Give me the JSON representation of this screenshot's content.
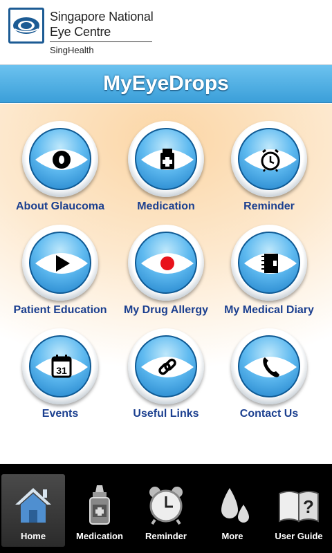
{
  "header": {
    "org_line1": "Singapore National",
    "org_line2": "Eye Centre",
    "org_line3": "SingHealth"
  },
  "app": {
    "title": "MyEyeDrops"
  },
  "colors": {
    "brand_blue": "#1c5b94",
    "label_blue": "#1b3f8f",
    "titlebar": "#4aaee2"
  },
  "tiles": [
    {
      "label": "About Glaucoma",
      "icon": "pupil-icon"
    },
    {
      "label": "Medication",
      "icon": "medicine-bottle-icon"
    },
    {
      "label": "Reminder",
      "icon": "alarm-clock-icon"
    },
    {
      "label": "Patient Education",
      "icon": "play-icon"
    },
    {
      "label": "My Drug Allergy",
      "icon": "red-dot-icon"
    },
    {
      "label": "My Medical Diary",
      "icon": "diary-icon"
    },
    {
      "label": "Events",
      "icon": "calendar-icon"
    },
    {
      "label": "Useful Links",
      "icon": "link-icon"
    },
    {
      "label": "Contact Us",
      "icon": "phone-icon"
    }
  ],
  "calendar_day": "31",
  "tabbar": {
    "items": [
      {
        "label": "Home",
        "icon": "home-icon",
        "active": true
      },
      {
        "label": "Medication",
        "icon": "eye-drop-bottle-icon",
        "active": false
      },
      {
        "label": "Reminder",
        "icon": "alarm-clock-icon",
        "active": false
      },
      {
        "label": "More",
        "icon": "droplets-icon",
        "active": false
      },
      {
        "label": "User Guide",
        "icon": "book-question-icon",
        "active": false
      }
    ]
  }
}
